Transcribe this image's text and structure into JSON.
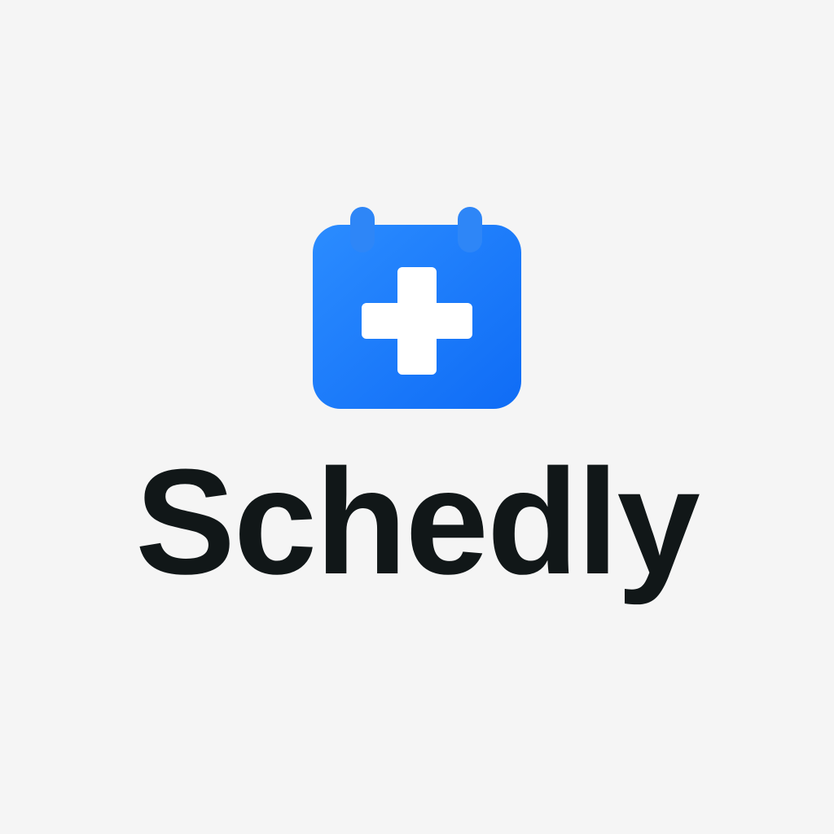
{
  "brand": {
    "name": "Schedly",
    "icon": "calendar-plus-icon",
    "colors": {
      "primary": "#1677ff",
      "primary_light": "#2b8cff",
      "text": "#111718",
      "background": "#f5f5f5",
      "symbol": "#ffffff"
    }
  }
}
